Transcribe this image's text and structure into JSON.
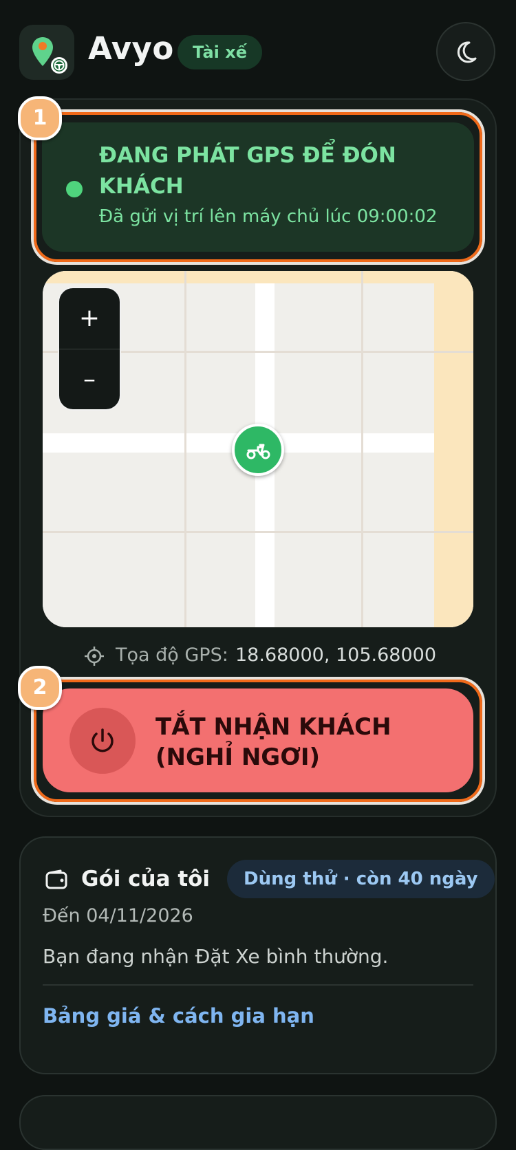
{
  "header": {
    "app_name": "Avyo",
    "role_badge": "Tài xế",
    "logo_icon": "map-pin-steering-wheel-icon",
    "theme_icon": "moon-icon"
  },
  "status": {
    "step": "1",
    "title": "ĐANG PHÁT GPS ĐỂ ĐÓN KHÁCH",
    "subtitle": "Đã gửi vị trí lên máy chủ lúc 09:00:02",
    "dot_color": "#4fd47d"
  },
  "map": {
    "zoom_in": "+",
    "zoom_out": "–",
    "marker_icon": "scooter-icon"
  },
  "gps": {
    "icon": "crosshair-icon",
    "label": "Tọa độ GPS:",
    "value": "18.68000, 105.68000"
  },
  "power": {
    "step": "2",
    "label": "TẮT NHẬN KHÁCH (NGHỈ NGƠI)",
    "icon": "power-icon",
    "color": "#f37070"
  },
  "plan": {
    "icon": "wallet-icon",
    "title": "Gói của tôi",
    "badge": "Dùng thử · còn 40 ngày",
    "expiry": "Đến 04/11/2026",
    "description": "Bạn đang nhận Đặt Xe bình thường.",
    "link": "Bảng giá & cách gia hạn"
  },
  "colors": {
    "background": "#0f1412",
    "accent_green": "#4fd47d",
    "highlight_orange": "#f06a1a",
    "link_blue": "#7fb5f0"
  }
}
